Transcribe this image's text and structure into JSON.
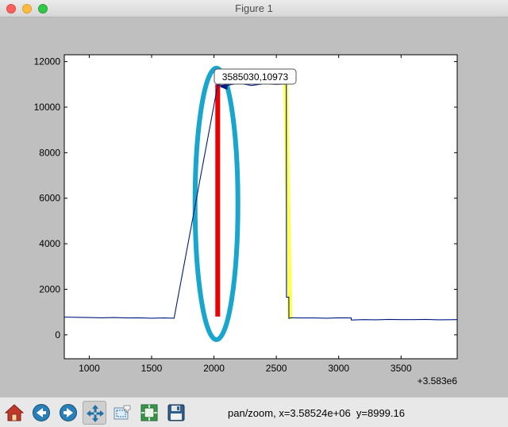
{
  "window": {
    "title": "Figure 1"
  },
  "toolbar": {
    "buttons": [
      {
        "id": "home",
        "icon": "home-icon"
      },
      {
        "id": "back",
        "icon": "back-arrow-icon"
      },
      {
        "id": "forward",
        "icon": "forward-arrow-icon"
      },
      {
        "id": "pan",
        "icon": "pan-move-icon",
        "active": true
      },
      {
        "id": "zoom",
        "icon": "zoom-rect-icon"
      },
      {
        "id": "subplots",
        "icon": "configure-subplots-icon"
      },
      {
        "id": "save",
        "icon": "save-floppy-icon"
      }
    ],
    "status": "pan/zoom, x=3.58524e+06  y=8999.16"
  },
  "chart_data": {
    "type": "line",
    "title": "",
    "xlabel": "",
    "ylabel": "",
    "x_offset_label": "+3.583e6",
    "xlim": [
      800,
      3950
    ],
    "ylim": [
      -1050,
      12300
    ],
    "x_ticks": [
      1000,
      1500,
      2000,
      2500,
      3000,
      3500
    ],
    "y_ticks": [
      0,
      2000,
      4000,
      6000,
      8000,
      10000,
      12000
    ],
    "grid": false,
    "series": [
      {
        "color": "#001a80",
        "x": [
          800,
          900,
          1000,
          1100,
          1200,
          1300,
          1400,
          1500,
          1600,
          1680,
          2030,
          2100,
          2200,
          2300,
          2400,
          2500,
          2580,
          2581,
          2600,
          2601,
          2620,
          2700,
          2800,
          2900,
          3000,
          3100,
          3101,
          3200,
          3300,
          3400,
          3500,
          3600,
          3700,
          3800,
          3950
        ],
        "y": [
          780,
          770,
          760,
          750,
          760,
          740,
          750,
          730,
          740,
          730,
          10973,
          10950,
          11050,
          10950,
          11020,
          11000,
          11010,
          1650,
          1660,
          720,
          750,
          740,
          740,
          730,
          750,
          740,
          650,
          670,
          660,
          680,
          670,
          670,
          680,
          660,
          670
        ]
      }
    ],
    "annotation": {
      "text": "3585030,10973",
      "x": 2030,
      "y": 10973
    },
    "markers": [
      {
        "kind": "vertical-bar",
        "color": "#ee0000",
        "x": 2030,
        "y_from": 800,
        "y_to": 11000
      },
      {
        "kind": "slanted-bar",
        "color": "#ffff55",
        "x_from": 2575,
        "x_to": 2610,
        "y_from": 11000,
        "y_to": 700
      },
      {
        "kind": "ellipse",
        "color": "#1aa6cc",
        "cx": 2020,
        "cy": 5750
      }
    ]
  }
}
